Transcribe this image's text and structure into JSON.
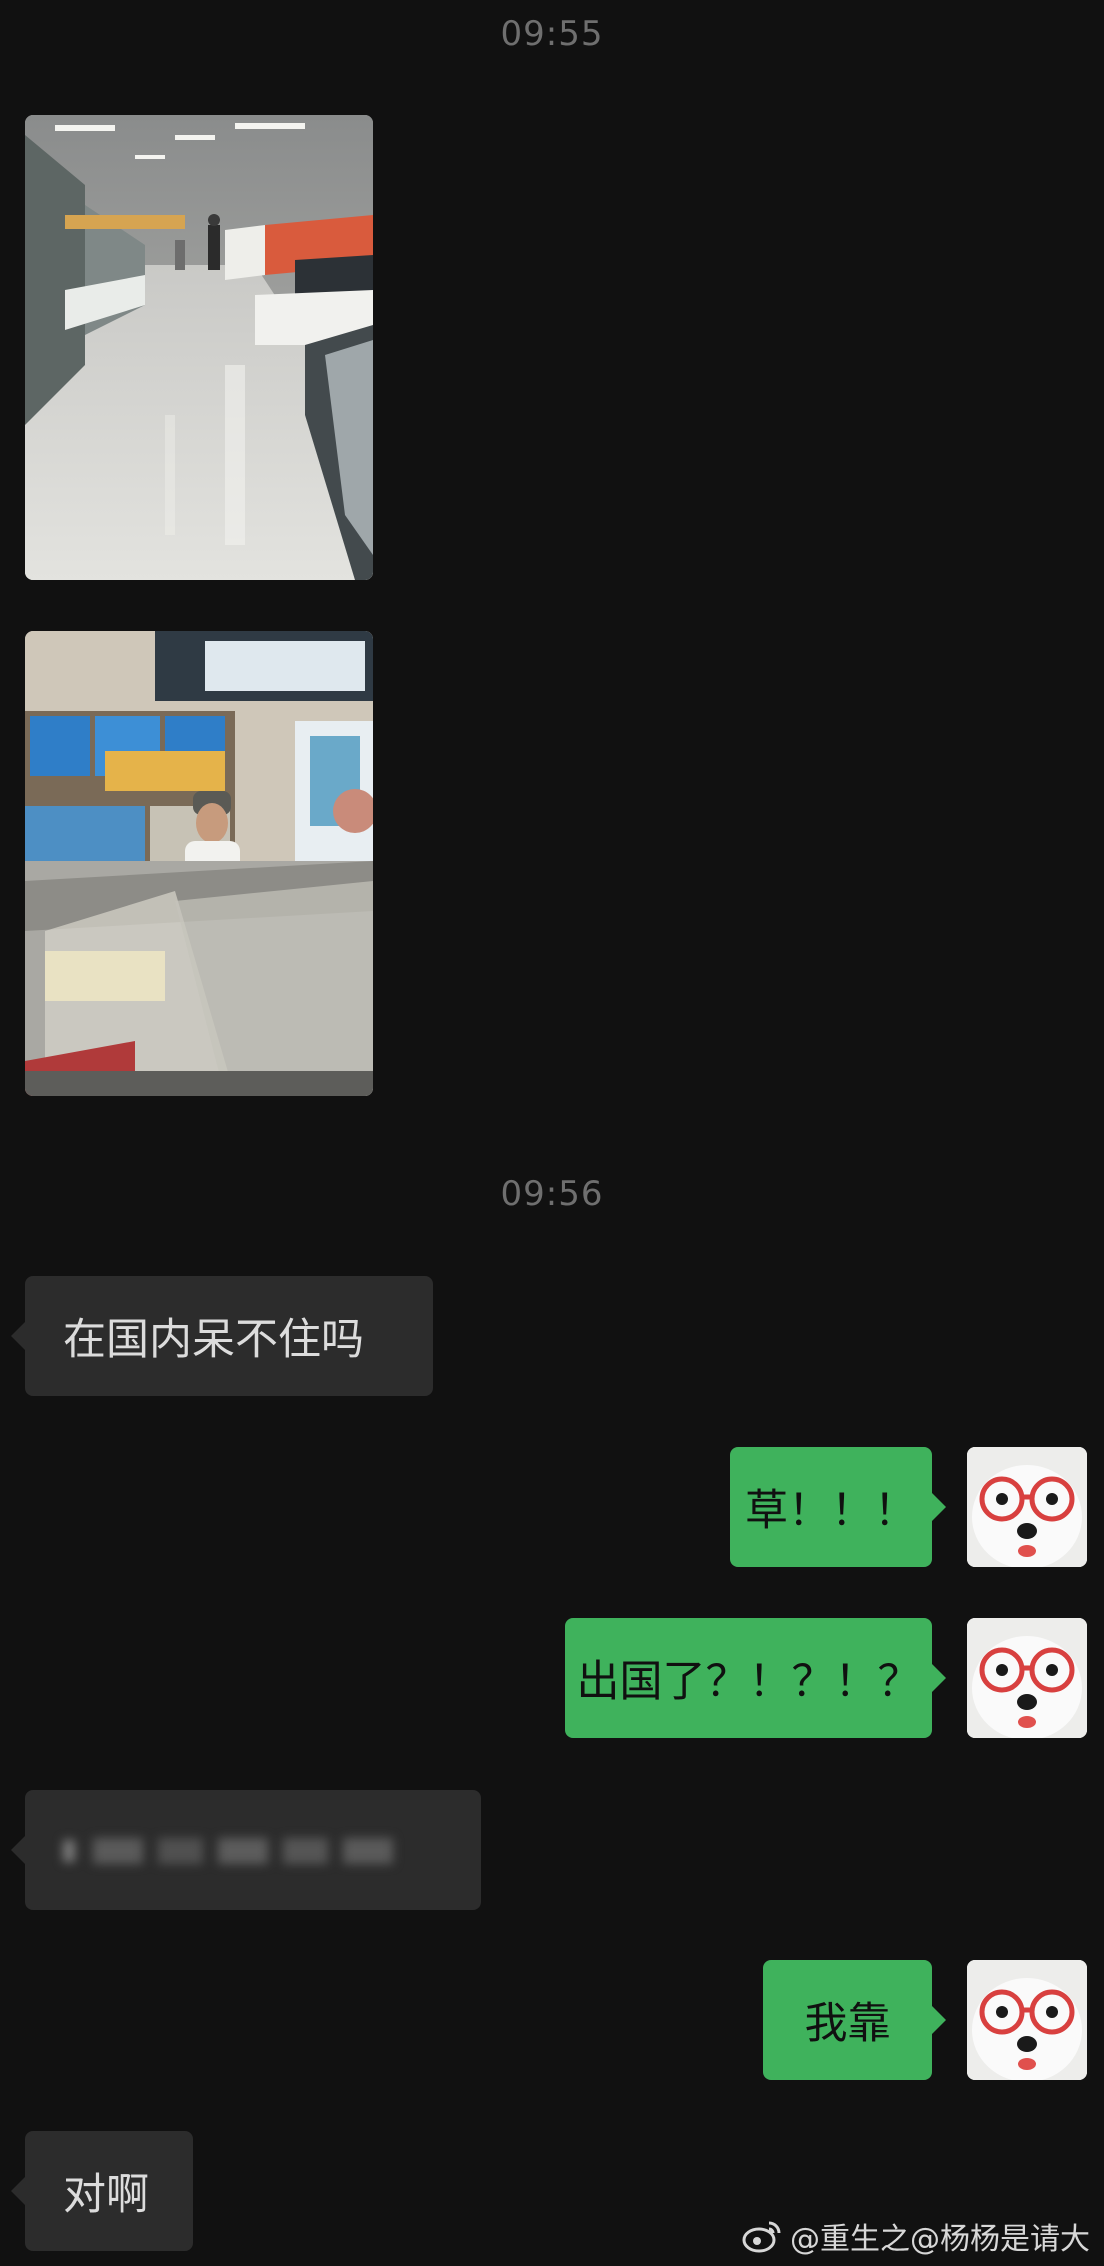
{
  "timestamps": [
    "09:55",
    "09:56"
  ],
  "messages": {
    "incoming_1": "在国内呆不住吗",
    "outgoing_1": "草！！！",
    "outgoing_2": "出国了？！？！？",
    "incoming_blurred": "",
    "outgoing_3": "我靠",
    "incoming_2": "对啊"
  },
  "photos": [
    {
      "icon": "photo-supermarket-aisle"
    },
    {
      "icon": "photo-supermarket-counter"
    }
  ],
  "avatar": {
    "icon": "white-dog-red-glasses-avatar"
  },
  "watermark": {
    "text": "@重生之@杨杨是请大",
    "icon": "weibo-logo-icon"
  },
  "colors": {
    "background": "#111111",
    "incoming_bubble": "#2c2c2c",
    "outgoing_bubble": "#3fb25c",
    "timestamp": "#6f6f6f"
  }
}
